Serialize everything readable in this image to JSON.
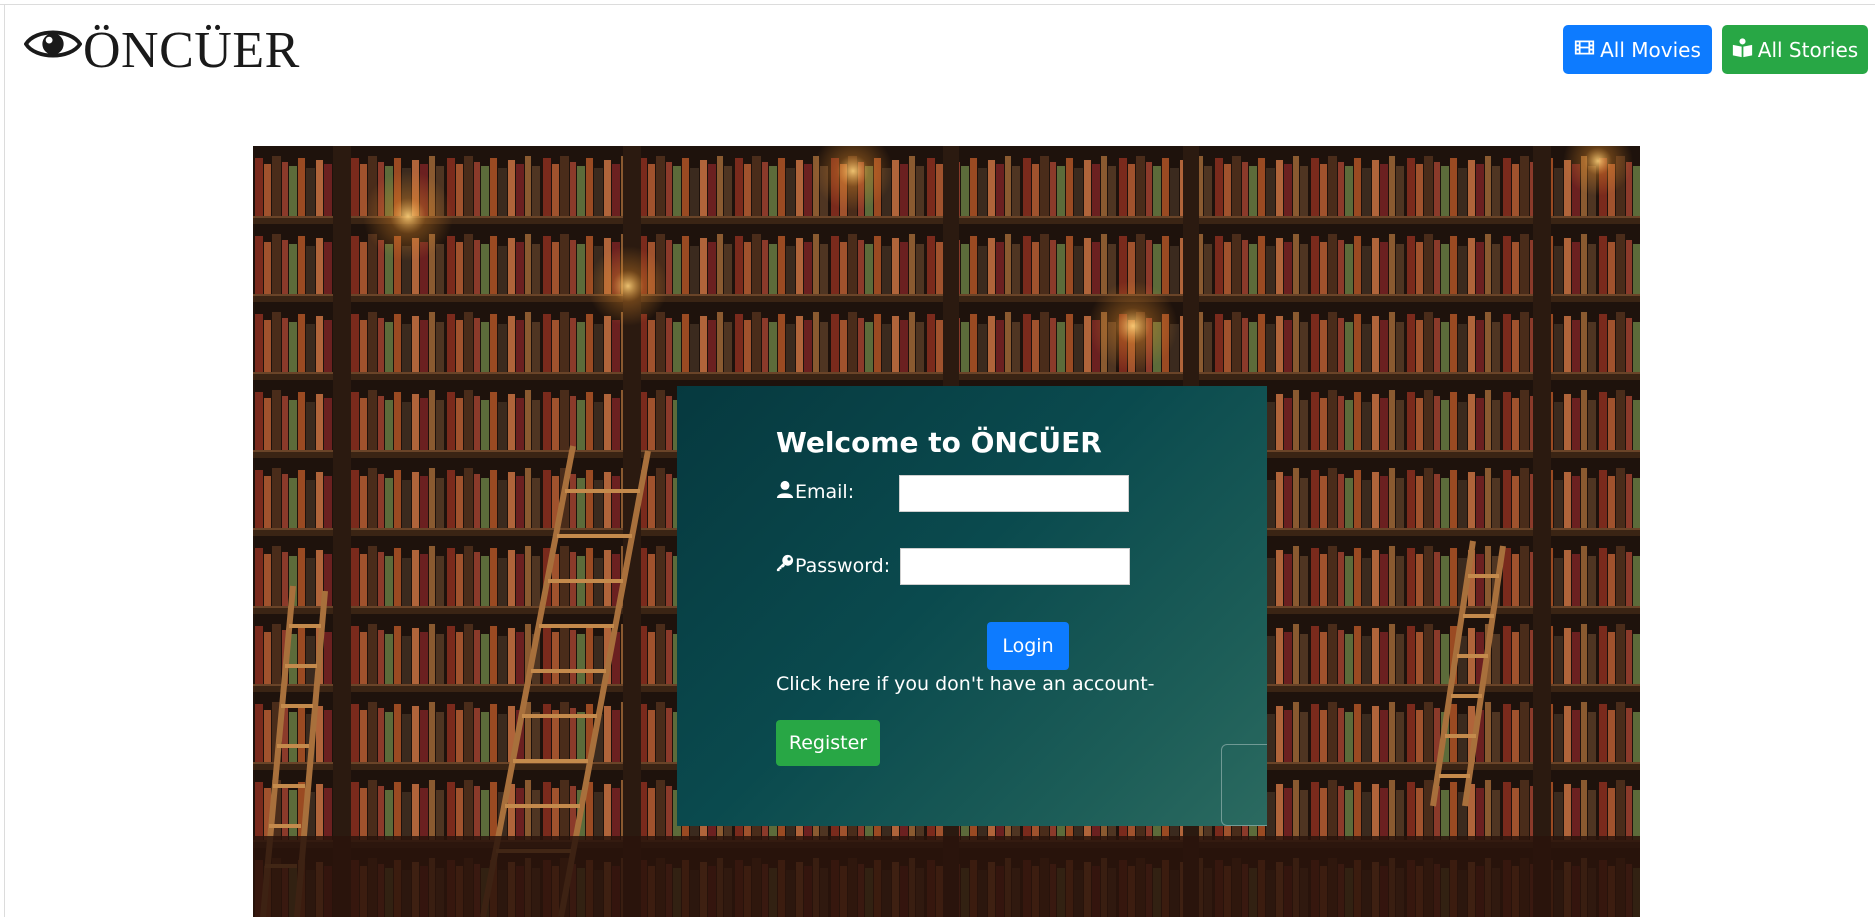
{
  "header": {
    "brand": "ÖNCÜER",
    "nav": {
      "movies_label": "All Movies",
      "stories_label": "All Stories"
    }
  },
  "login": {
    "title": "Welcome to ÖNCÜER",
    "email_label": "Email:",
    "email_value": "",
    "password_label": "Password:",
    "password_value": "",
    "login_button": "Login",
    "signup_prompt": "Click here if you don't have an account-",
    "register_button": "Register"
  },
  "icons": {
    "brand": "eye-icon",
    "movies": "film-icon",
    "stories": "book-reader-icon",
    "email": "user-icon",
    "password": "key-icon"
  },
  "colors": {
    "primary": "#0d7bff",
    "success": "#28a745",
    "card_start": "#06393f",
    "card_end": "#2b6a60"
  }
}
